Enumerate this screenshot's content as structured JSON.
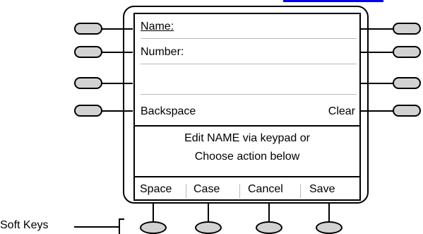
{
  "screen": {
    "name_label_prefix": "N",
    "name_label_rest": "ame:",
    "number_label": "Number:",
    "backspace_label": "Backspace",
    "clear_label": "Clear",
    "message_line1": "Edit NAME via keypad or",
    "message_line2": "Choose action below"
  },
  "softkeys": [
    "Space",
    "Case",
    "Cancel",
    "Save"
  ],
  "caption": "Soft Keys",
  "colors": {
    "key_fill": "#d2d2d2",
    "divider": "#b9b9b9",
    "link": "#0000ee"
  }
}
